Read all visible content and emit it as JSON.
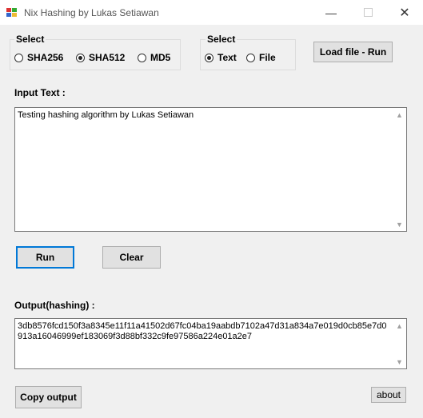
{
  "window": {
    "title": "Nix Hashing by Lukas Setiawan"
  },
  "algorithm_group": {
    "label": "Select",
    "options": [
      {
        "label": "SHA256",
        "selected": false
      },
      {
        "label": "SHA512",
        "selected": true
      },
      {
        "label": "MD5",
        "selected": false
      }
    ]
  },
  "source_group": {
    "label": "Select",
    "options": [
      {
        "label": "Text",
        "selected": true
      },
      {
        "label": "File",
        "selected": false
      }
    ]
  },
  "buttons": {
    "load_file_run": "Load file - Run",
    "run": "Run",
    "clear": "Clear",
    "copy_output": "Copy output",
    "about": "about"
  },
  "input": {
    "label": "Input  Text :",
    "value": "Testing hashing algorithm by Lukas Setiawan"
  },
  "output": {
    "label": "Output(hashing) :",
    "value": "3db8576fcd150f3a8345e11f11a41502d67fc04ba19aabdb7102a47d31a834a7e019d0cb85e7d0913a16046999ef183069f3d88bf332c9fe97586a224e01a2e7"
  }
}
